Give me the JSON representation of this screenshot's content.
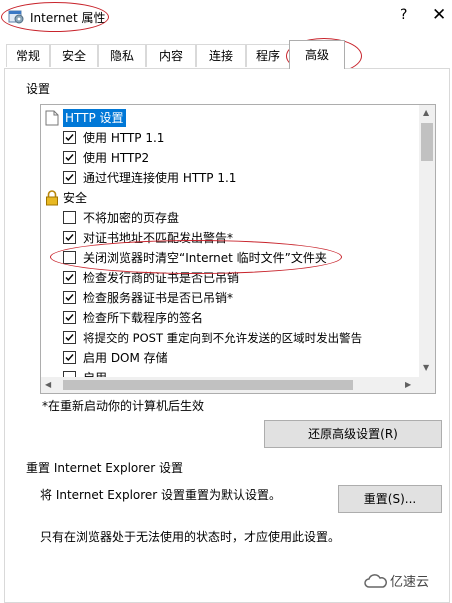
{
  "window": {
    "title": "Internet 属性",
    "help": "?",
    "close": "✕"
  },
  "tabs": [
    {
      "label": "常规"
    },
    {
      "label": "安全"
    },
    {
      "label": "隐私"
    },
    {
      "label": "内容"
    },
    {
      "label": "连接"
    },
    {
      "label": "程序"
    },
    {
      "label": "高级",
      "active": true
    }
  ],
  "advanced": {
    "settings_label": "设置",
    "items": [
      {
        "type": "category",
        "label": "HTTP 设置",
        "icon": "page-icon",
        "selected": true
      },
      {
        "type": "option",
        "label": "使用 HTTP 1.1",
        "checked": true
      },
      {
        "type": "option",
        "label": "使用 HTTP2",
        "checked": true
      },
      {
        "type": "option",
        "label": "通过代理连接使用 HTTP 1.1",
        "checked": true
      },
      {
        "type": "category",
        "label": "安全",
        "icon": "lock-icon"
      },
      {
        "type": "option",
        "label": "不将加密的页存盘",
        "checked": false
      },
      {
        "type": "option",
        "label": "对证书地址不匹配发出警告*",
        "checked": true
      },
      {
        "type": "option",
        "label": "关闭浏览器时清空“Internet 临时文件”文件夹",
        "checked": false
      },
      {
        "type": "option",
        "label": "检查发行商的证书是否已吊销",
        "checked": true
      },
      {
        "type": "option",
        "label": "检查服务器证书是否已吊销*",
        "checked": true
      },
      {
        "type": "option",
        "label": "检查所下载程序的签名",
        "checked": true
      },
      {
        "type": "option",
        "label": "将提交的 POST 重定向到不允许发送的区域时发出警告",
        "checked": true
      },
      {
        "type": "option",
        "label": "启用 DOM 存储",
        "checked": true
      },
      {
        "type": "option",
        "label": "启用 ...........",
        "checked": true
      }
    ],
    "restart_note": "*在重新启动你的计算机后生效",
    "restore_button": "还原高级设置(R)",
    "reset_group_label": "重置 Internet Explorer 设置",
    "reset_desc": "将 Internet Explorer 设置重置为默认设置。",
    "reset_button": "重置(S)...",
    "reset_note": "只有在浏览器处于无法使用的状态时，才应使用此设置。"
  },
  "watermark": {
    "text": "亿速云"
  },
  "colors": {
    "selection": "#0078d7",
    "annotation": "#c8242c",
    "button_bg": "#e1e1e1"
  }
}
